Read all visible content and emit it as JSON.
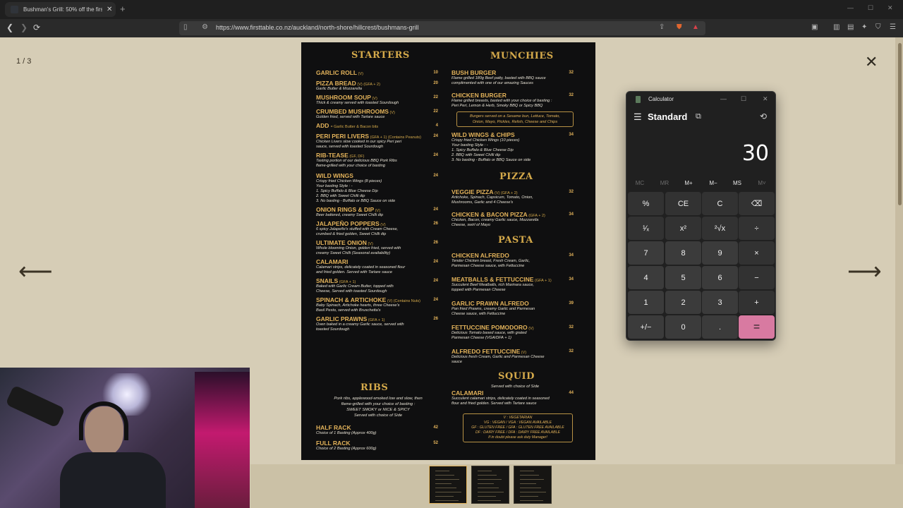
{
  "browser": {
    "tab_title": "Bushman's Grill: 50% off the first...",
    "new_tab": "+",
    "url": "https://www.firsttable.co.nz/auckland/north-shore/hillcrest/bushmans-grill"
  },
  "viewer": {
    "counter": "1 / 3",
    "close": "✕",
    "prev": "⟵",
    "next": "⟶"
  },
  "menu": {
    "left": {
      "starters_title": "STARTERS",
      "items": [
        {
          "name": "GARLIC ROLL",
          "tag": "(V)",
          "desc": "",
          "price": "10"
        },
        {
          "name": "PIZZA BREAD",
          "tag": "(V) (GFA + 2)",
          "desc": "Garlic Butter & Mozzarella",
          "price": "20"
        },
        {
          "name": "MUSHROOM SOUP",
          "tag": "(V)",
          "desc": "Thick & creamy served with toasted Sourdough",
          "price": "22"
        },
        {
          "name": "CRUMBED MUSHROOMS",
          "tag": "(V)",
          "desc": "Golden fried, served with Tartare sauce",
          "price": "22"
        },
        {
          "name": "ADD -",
          "tag": "Garlic Butter & Bacon bits",
          "desc": "",
          "price": "4"
        },
        {
          "name": "PERI PERI LIVERS",
          "tag": "(GFA + 1) (Contains Peanuts)",
          "desc": "Chicken Livers slow cooked in our spicy Peri peri\nsauce, served with toasted Sourdough",
          "price": "24"
        },
        {
          "name": "RIB-TEASE",
          "tag": "(GF, DF)",
          "desc": "Tasting portion of our delicious BBQ Pork Ribs\nflame-grilled with your choice of basting",
          "price": "24"
        },
        {
          "name": "WILD WINGS",
          "tag": "",
          "desc": "Crispy fried Chicken Wings (8 pieces)\nYour basting Style : -\n1. Spicy Buffalo & Blue Cheese Dip\n2. BBQ with Sweet Chilli dip\n3. No basting - Buffalo or BBQ Sauce on side",
          "price": "24"
        },
        {
          "name": "ONION RINGS & DIP",
          "tag": "(V)",
          "desc": "Beer battered, creamy Sweet Chilli dip",
          "price": "24"
        },
        {
          "name": "JALAPEÑO POPPERS",
          "tag": "(V)",
          "desc": "6 spicy Jalapeño's stuffed with Cream Cheese,\ncrumbed & fried golden, Sweet Chilli dip",
          "price": "26"
        },
        {
          "name": "ULTIMATE ONION",
          "tag": "(V)",
          "desc": "Whole blooming Onion, golden fried, served with\ncreamy Sweet Chilli (Seasonal availability)",
          "price": "26"
        },
        {
          "name": "CALAMARI",
          "tag": "",
          "desc": "Calamari strips, delicately coated in seasoned flour\nand fried golden. Served with Tartare sauce",
          "price": "24"
        },
        {
          "name": "SNAILS",
          "tag": "(GFA + 1)",
          "desc": "Baked with Garlic Cream Butter, topped with\nCheese, Served with toasted Sourdough",
          "price": "24"
        },
        {
          "name": "SPINACH & ARTICHOKE",
          "tag": "(V) (Contains Nuts)",
          "desc": "Baby Spinach, Artichoke hearts, three Cheese's\nBasil Pesto, served with Bruschetta's",
          "price": "24"
        },
        {
          "name": "GARLIC PRAWNS",
          "tag": "(GFA + 1)",
          "desc": "Oven baked in a creamy Garlic sauce, served with\ntoasted Sourdough",
          "price": "26"
        }
      ],
      "ribs_title": "RIBS",
      "ribs_note": "Pork ribs, applewood-smoked low and slow, then\nflame-grilled with your choice of basting :\nSWEET SMOKY or NICE & SPICY\nServed with choice of Side",
      "ribs_items": [
        {
          "name": "HALF RACK",
          "desc": "Choice of 1 Basting (Approx 400g)",
          "price": "42"
        },
        {
          "name": "FULL RACK",
          "desc": "Choice of 2 Basting (Approx 600g)",
          "price": "52"
        }
      ]
    },
    "right": {
      "munchies_title": "MUNCHIES",
      "munchies": [
        {
          "name": "BUSH BURGER",
          "tag": "",
          "desc": "Flame grilled 180g Beef patty, basted with BBQ sauce\ncomplimented with one of our amazing Sauces",
          "price": "32"
        },
        {
          "name": "CHICKEN BURGER",
          "tag": "",
          "desc": "Flame grilled breasts, basted with your choice of basting :\nPeri Peri, Lemon & Herb, Smoky BBQ or Spicy BBQ",
          "price": "32"
        }
      ],
      "burger_box": "Burgers served on a Sesame bun, Lettuce, Tomato,\nOnion, Mayo, Pickles, Relish, Cheese and Chips",
      "wings": {
        "name": "WILD WINGS & CHIPS",
        "desc": "Crispy fried Chicken Wings (10 pieces)\nYour basting Style : -\n1. Spicy Buffalo & Blue Cheese Dip\n2. BBQ with Sweet Chilli dip\n3. No basting - Buffalo or BBQ Sauce on side",
        "price": "34"
      },
      "pizza_title": "PIZZA",
      "pizza": [
        {
          "name": "VEGGIE PIZZA",
          "tag": "(V) (GFA + 2)",
          "desc": "Artichoke, Spinach, Capsicum, Tomato, Onion,\nMushrooms, Garlic and 4 Cheese's",
          "price": "32"
        },
        {
          "name": "CHICKEN & BACON PIZZA",
          "tag": "(GFA + 2)",
          "desc": "Chicken, Bacon, creamy Garlic sauce, Mozzarella\nCheese, swirl of Mayo",
          "price": "34"
        }
      ],
      "pasta_title": "PASTA",
      "pasta": [
        {
          "name": "CHICKEN ALFREDO",
          "tag": "",
          "desc": "Tender Chicken breast, Fresh Cream, Garlic,\nParmesan Cheese sauce, with Fettuccine",
          "price": "34"
        },
        {
          "name": "MEATBALLS & FETTUCCINE",
          "tag": "(GFA + 1)",
          "desc": "Succulent Beef Meatballs, rich Marinara sauce,\ntopped with Parmesan Cheese",
          "price": "34"
        },
        {
          "name": "GARLIC PRAWN ALFREDO",
          "tag": "",
          "desc": "Pan fried Prawns, creamy Garlic and Parmesan\nCheese sauce, with Fettuccine",
          "price": "39"
        },
        {
          "name": "FETTUCCINE POMODORO",
          "tag": "(V)",
          "desc": "Delicious Tomato based sauce, with grated\nParmesan Cheese (VGA/DFA + 1)",
          "price": "32"
        },
        {
          "name": "ALFREDO FETTUCCINE",
          "tag": "(V)",
          "desc": "Delicious fresh Cream, Garlic and Parmesan Cheese\nsauce",
          "price": "32"
        }
      ],
      "squid_title": "SQUID",
      "squid_note": "Served with choice of Side",
      "squid_item": {
        "name": "CALAMARI",
        "desc": "Succulent calamari strips, delicately coated in seasoned\nflour and fried golden. Served with Tartare sauce",
        "price": "44"
      },
      "legend_box": "V : VEGETARIAN\nVG : VEGAN / VGA : VEGAN AVAILABLE\nGF : GLUTEN FREE / GFA : GLUTEN FREE AVAILABLE\nDF : DAIRY FREE / DFA : DAIRY FREE AVAILABLE\nIf in doubt please ask duty Manager!"
    }
  },
  "calculator": {
    "title": "Calculator",
    "mode": "Standard",
    "display": "30",
    "memory": [
      {
        "label": "MC",
        "enabled": false
      },
      {
        "label": "MR",
        "enabled": false
      },
      {
        "label": "M+",
        "enabled": true
      },
      {
        "label": "M−",
        "enabled": true
      },
      {
        "label": "MS",
        "enabled": true
      },
      {
        "label": "M˅",
        "enabled": false
      }
    ],
    "keys": [
      [
        "%",
        "CE",
        "C",
        "⌫"
      ],
      [
        "¹⁄ₓ",
        "x²",
        "²√x",
        "÷"
      ],
      [
        "7",
        "8",
        "9",
        "×"
      ],
      [
        "4",
        "5",
        "6",
        "−"
      ],
      [
        "1",
        "2",
        "3",
        "+"
      ],
      [
        "+/−",
        "0",
        ".",
        "="
      ]
    ],
    "accent": "#d87aa1"
  }
}
